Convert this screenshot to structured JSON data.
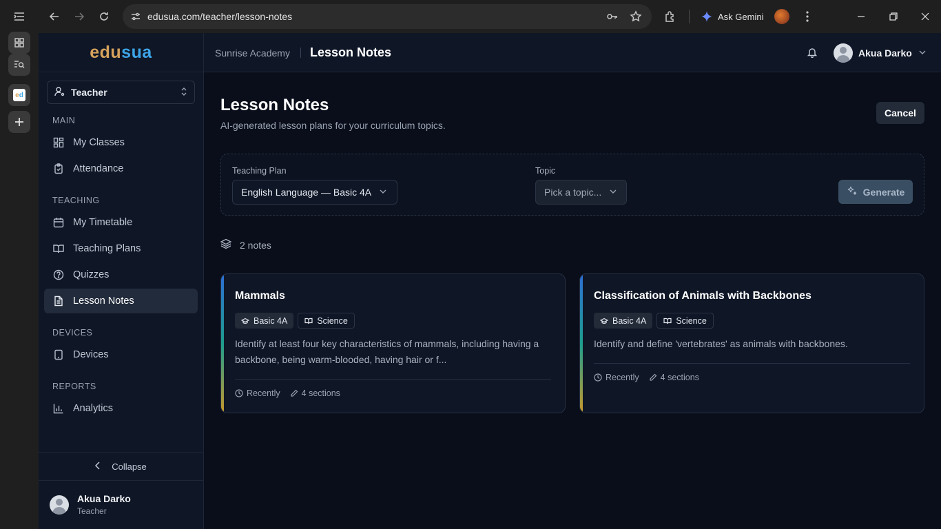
{
  "browser": {
    "url": "edusua.com/teacher/lesson-notes",
    "gemini_label": "Ask Gemini",
    "icons": [
      "tab-list-icon",
      "back-icon",
      "forward-icon",
      "reload-icon",
      "site-settings-icon",
      "password-key-icon",
      "bookmark-star-icon",
      "extensions-icon",
      "gemini-icon",
      "profile-icon",
      "menu-icon",
      "minimize-icon",
      "restore-icon",
      "close-icon"
    ]
  },
  "brand": {
    "part1": "edu",
    "part2": "sua"
  },
  "role_select": {
    "value": "Teacher"
  },
  "sidebar": {
    "sections": [
      {
        "label": "MAIN",
        "items": [
          {
            "label": "My Classes",
            "icon": "grid-icon"
          },
          {
            "label": "Attendance",
            "icon": "clipboard-check-icon"
          }
        ]
      },
      {
        "label": "TEACHING",
        "items": [
          {
            "label": "My Timetable",
            "icon": "calendar-icon"
          },
          {
            "label": "Teaching Plans",
            "icon": "book-open-icon"
          },
          {
            "label": "Quizzes",
            "icon": "help-circle-icon"
          },
          {
            "label": "Lesson Notes",
            "icon": "file-text-icon",
            "active": true
          }
        ]
      },
      {
        "label": "DEVICES",
        "items": [
          {
            "label": "Devices",
            "icon": "tablet-icon"
          }
        ]
      },
      {
        "label": "REPORTS",
        "items": [
          {
            "label": "Analytics",
            "icon": "bar-chart-icon"
          }
        ]
      }
    ],
    "collapse_label": "Collapse",
    "user": {
      "name": "Akua Darko",
      "role": "Teacher"
    }
  },
  "header": {
    "school": "Sunrise Academy",
    "page": "Lesson Notes",
    "user_name": "Akua Darko"
  },
  "main": {
    "title": "Lesson Notes",
    "subtitle": "AI-generated lesson plans for your curriculum topics.",
    "cancel_label": "Cancel",
    "teaching_plan_label": "Teaching Plan",
    "teaching_plan_value": "English Language — Basic 4A",
    "topic_label": "Topic",
    "topic_placeholder": "Pick a topic...",
    "generate_label": "Generate",
    "count_text": "2 notes",
    "notes": [
      {
        "title": "Mammals",
        "class_tag": "Basic 4A",
        "subject_tag": "Science",
        "description": "Identify at least four key characteristics of mammals, including having a backbone, being warm-blooded, having hair or f...",
        "time": "Recently",
        "sections": "4 sections"
      },
      {
        "title": "Classification of Animals with Backbones",
        "class_tag": "Basic 4A",
        "subject_tag": "Science",
        "description": "Identify and define 'vertebrates' as animals with backbones.",
        "time": "Recently",
        "sections": "4 sections"
      }
    ]
  },
  "colors": {
    "brand_edu": "#d6a35c",
    "brand_sua": "#3da5e8",
    "background": "#090e1a",
    "sidebar": "#0f1626",
    "generate_button": "#3a4e63"
  }
}
